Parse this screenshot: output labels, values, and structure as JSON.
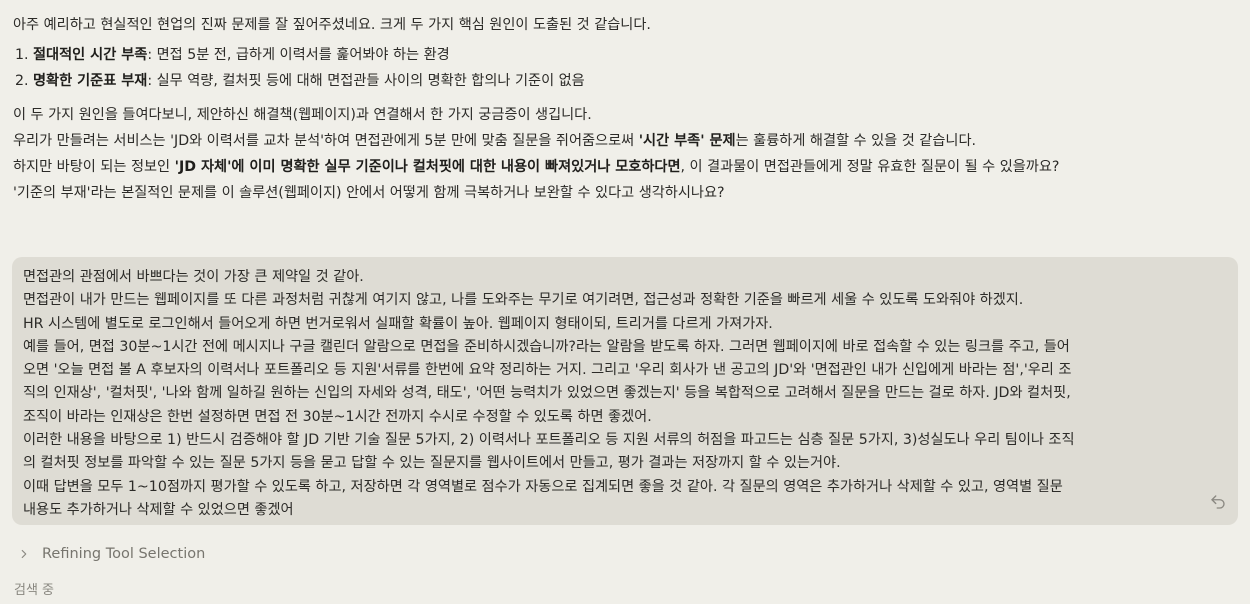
{
  "assistant": {
    "intro": "아주 예리하고 현실적인 현업의 진짜 문제를 잘 짚어주셨네요. 크게 두 가지 핵심 원인이 도출된 것 같습니다.",
    "causes": [
      {
        "title": "절대적인 시간 부족",
        "rest": ": 면접 5분 전, 급하게 이력서를 훑어봐야 하는 환경"
      },
      {
        "title": "명확한 기준표 부재",
        "rest": ": 실무 역량, 컬처핏 등에 대해 면접관들 사이의 명확한 합의나 기준이 없음"
      }
    ],
    "para1": "이 두 가지 원인을 들여다보니, 제안하신 해결책(웹페이지)과 연결해서 한 가지 궁금증이 생깁니다.",
    "para2_a": "우리가 만들려는 서비스는 'JD와 이력서를 교차 분석'하여 면접관에게 5분 만에 맞춤 질문을 쥐어줌으로써 ",
    "para2_bold": "'시간 부족' 문제",
    "para2_b": "는 훌륭하게 해결할 수 있을 것 같습니다.",
    "para3_a": "하지만 바탕이 되는 정보인 ",
    "para3_bold": "'JD 자체'에 이미 명확한 실무 기준이나 컬처핏에 대한 내용이 빠져있거나 모호하다면",
    "para3_b": ", 이 결과물이 면접관들에게 정말 유효한 질문이 될 수 있을까요?",
    "para4": "'기준의 부재'라는 본질적인 문제를 이 솔루션(웹페이지) 안에서 어떻게 함께 극복하거나 보완할 수 있다고 생각하시나요?"
  },
  "user_message": {
    "lines": [
      "면접관의 관점에서 바쁘다는 것이 가장 큰 제약일 것 같아.",
      "면접관이 내가 만드는 웹페이지를 또 다른 과정처럼 귀찮게 여기지 않고, 나를 도와주는 무기로 여기려면, 접근성과 정확한 기준을 빠르게 세울 수 있도록 도와줘야 하겠지.",
      "HR 시스템에 별도로 로그인해서 들어오게 하면 번거로워서 실패할 확률이 높아. 웹페이지 형태이되, 트리거를 다르게 가져가자.",
      "예를 들어, 면접 30분~1시간 전에 메시지나 구글 캘린더 알람으로 면접을 준비하시겠습니까?라는 알람을 받도록 하자. 그러면 웹페이지에 바로 접속할 수 있는 링크를 주고, 들어",
      "오면 '오늘 면접 볼 A 후보자의 이력서나 포트폴리오 등 지원'서류를 한번에 요약 정리하는 거지. 그리고 '우리 회사가 낸 공고의 JD'와 '면접관인 내가 신입에게 바라는 점','우리 조",
      "직의 인재상', '컬처핏', '나와 함께 일하길 원하는 신입의 자세와 성격, 태도', '어떤 능력치가 있었으면 좋겠는지' 등을 복합적으로 고려해서 질문을 만드는 걸로 하자. JD와 컬처핏,",
      "조직이 바라는 인재상은  한번 설정하면 면접 전 30분~1시간 전까지 수시로 수정할 수 있도록 하면 좋겠어.",
      "이러한 내용을 바탕으로 1) 반드시 검증해야 할 JD 기반 기술 질문 5가지, 2) 이력서나 포트폴리오 등 지원 서류의 허점을 파고드는 심층 질문 5가지, 3)성실도나 우리 팀이나 조직",
      "의 컬처핏 정보를 파악할 수 있는 질문 5가지 등을 묻고 답할 수 있는 질문지를 웹사이트에서 만들고, 평가 결과는 저장까지 할 수 있는거야.",
      "이때 답변을 모두 1~10점까지 평가할 수 있도록 하고, 저장하면 각 영역별로 점수가 자동으로 집계되면 좋을 것 같아. 각 질문의 영역은 추가하거나 삭제할 수 있고, 영역별 질문",
      "내용도 추가하거나 삭제할 수 있었으면 좋겠어"
    ],
    "undo_icon": "undo-icon"
  },
  "thinking": {
    "label": "Refining Tool Selection",
    "icon": "chevron-right-icon"
  },
  "bottom_fragment": "검색 중"
}
